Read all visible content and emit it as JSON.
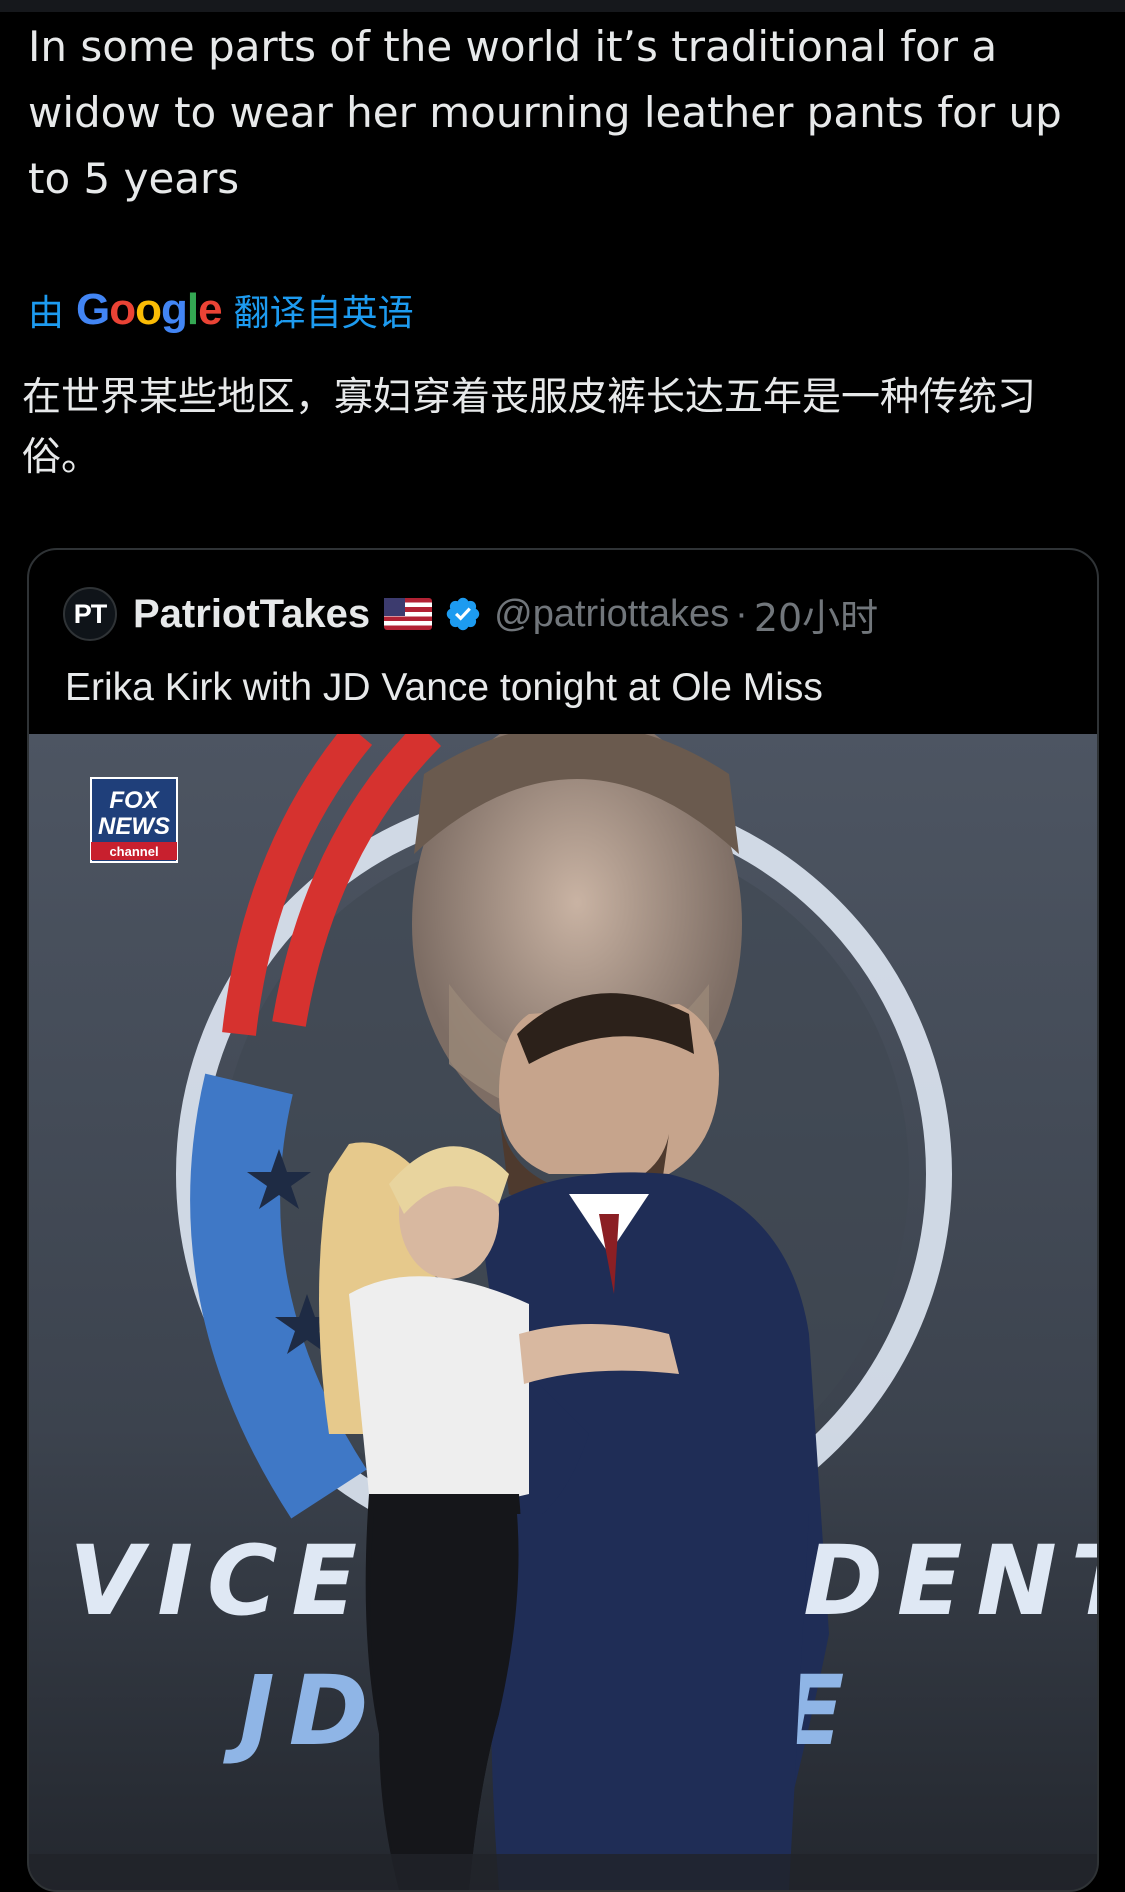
{
  "tweet": {
    "text": "In some parts of the world it’s traditional for a widow to wear her mourning leather pants for up to 5 years"
  },
  "translation": {
    "prefix": "由",
    "provider_letters": [
      "G",
      "o",
      "o",
      "g",
      "l",
      "e"
    ],
    "suffix": "翻译自英语",
    "text": "在世界某些地区，寡妇穿着丧服皮裤长达五年是一种传统习俗。"
  },
  "quoted_tweet": {
    "avatar_initials": "PT",
    "display_name": "PatriotTakes",
    "handle": "@patriottakes",
    "separator": "·",
    "time": "20小时",
    "text": "Erika Kirk with JD Vance tonight at Ole Miss",
    "media": {
      "logo_lines": [
        "FOX",
        "NEWS",
        "channel"
      ],
      "banner_line1": "VICE PRESIDENT",
      "banner_line2": "JD VANCE"
    }
  },
  "colors": {
    "background": "#000000",
    "text": "#e7e9ea",
    "secondary": "#71767b",
    "accent": "#1d9bf0",
    "border": "#2f3336"
  },
  "icons": {
    "flag": "us-flag-icon",
    "verified": "verified-badge-icon"
  }
}
